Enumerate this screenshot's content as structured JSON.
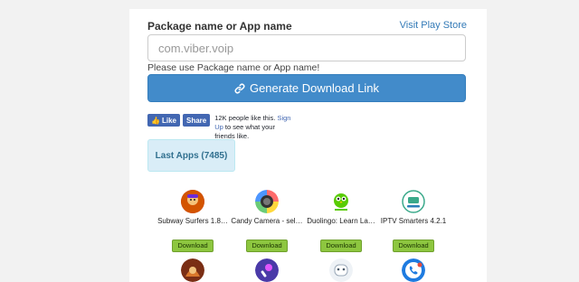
{
  "form": {
    "label": "Package name or App name",
    "store_link": "Visit Play Store",
    "input_placeholder": "com.viber.voip",
    "hint": "Please use Package name or App name!",
    "generate_label": "Generate Download Link"
  },
  "facebook": {
    "like_label": "Like",
    "share_label": "Share",
    "count_text": "12K people like this.",
    "signup_label": "Sign Up",
    "suffix_text": "to see what your friends like."
  },
  "last_apps": {
    "label": "Last Apps (7485)"
  },
  "apps": [
    {
      "name": "Subway Surfers 1.8…",
      "download_label": "Download",
      "icon": "subway-surfers-icon",
      "color": "#c0392b"
    },
    {
      "name": "Candy Camera - sel…",
      "download_label": "Download",
      "icon": "candy-camera-icon",
      "color": "#e74c3c"
    },
    {
      "name": "Duolingo: Learn La…",
      "download_label": "Download",
      "icon": "duolingo-icon",
      "color": "#58cc02"
    },
    {
      "name": "IPTV Smarters 4.2.1",
      "download_label": "Download",
      "icon": "iptv-smarters-icon",
      "color": "#3aa98a"
    }
  ],
  "row2_icons": [
    {
      "icon": "game-character-icon",
      "color": "#8e3b1f"
    },
    {
      "icon": "music-mic-icon",
      "color": "#4a3aa8"
    },
    {
      "icon": "robot-face-icon",
      "color": "#dfe6ee"
    },
    {
      "icon": "phone-call-icon",
      "color": "#1e7be0"
    }
  ]
}
